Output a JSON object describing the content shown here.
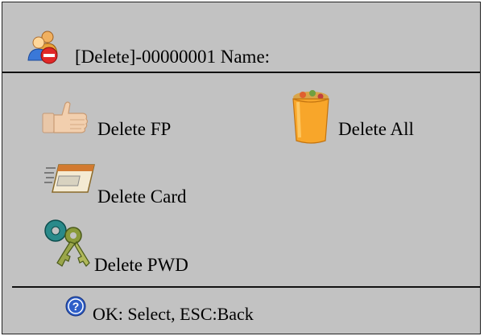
{
  "header": {
    "title": "[Delete]-00000001 Name:",
    "icon": "delete-user-icon"
  },
  "menu": {
    "items": [
      {
        "label": "Delete FP",
        "icon": "thumb-icon"
      },
      {
        "label": "Delete All",
        "icon": "trash-bin-icon"
      },
      {
        "label": "Delete Card",
        "icon": "card-icon"
      },
      {
        "label": "Delete PWD",
        "icon": "keys-icon"
      }
    ]
  },
  "footer": {
    "hint": "OK: Select, ESC:Back",
    "icon": "help-icon"
  },
  "colors": {
    "background": "#c2c2c2",
    "text": "#000000",
    "divider": "#111111"
  }
}
